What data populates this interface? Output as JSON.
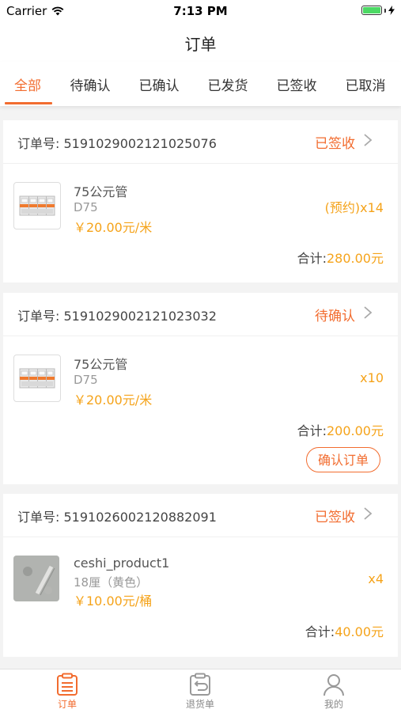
{
  "status_bar": {
    "carrier": "Carrier",
    "time": "7:13 PM",
    "battery_level": 1.0
  },
  "nav": {
    "title": "订单"
  },
  "tabs": [
    {
      "label": "全部",
      "active": true
    },
    {
      "label": "待确认"
    },
    {
      "label": "已确认"
    },
    {
      "label": "已发货"
    },
    {
      "label": "已签收"
    },
    {
      "label": "已取消"
    }
  ],
  "orders": [
    {
      "order_no": "订单号: 5191029002121025076",
      "status": "已签收",
      "item": {
        "name": "75公元管",
        "spec": "D75",
        "price": "￥20.00元/米",
        "qty": "(预约)x14",
        "image": "circuit-breaker-icon"
      },
      "total_label": "合计:",
      "total_amount": "280.00元"
    },
    {
      "order_no": "订单号: 5191029002121023032",
      "status": "待确认",
      "item": {
        "name": "75公元管",
        "spec": "D75",
        "price": "￥20.00元/米",
        "qty": "x10",
        "image": "circuit-breaker-icon"
      },
      "total_label": "合计:",
      "total_amount": "200.00元",
      "action": "确认订单"
    },
    {
      "order_no": "订单号: 5191026002120882091",
      "status": "已签收",
      "item": {
        "name": "ceshi_product1",
        "spec": "18厘（黄色）",
        "price": "￥10.00元/桶",
        "qty": "x4",
        "image": "product-photo"
      },
      "total_label": "合计:",
      "total_amount": "40.00元"
    }
  ],
  "tabbar": [
    {
      "label": "订单",
      "icon": "clipboard-icon",
      "active": true
    },
    {
      "label": "退货单",
      "icon": "return-icon"
    },
    {
      "label": "我的",
      "icon": "user-icon"
    }
  ],
  "colors": {
    "accent": "#f26c2f",
    "price": "#f5a31a"
  }
}
